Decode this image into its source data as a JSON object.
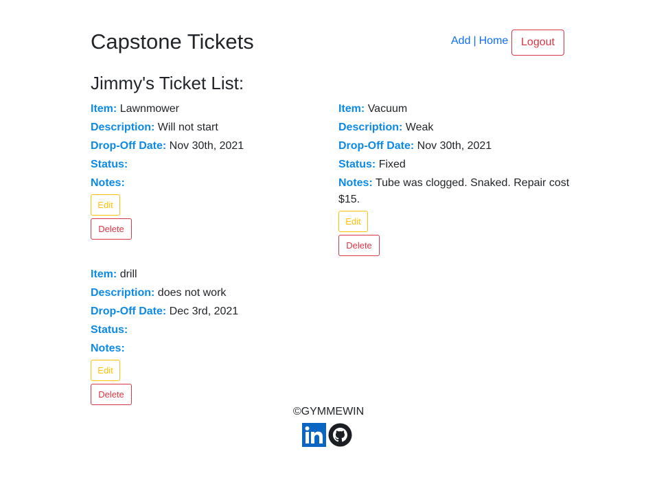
{
  "header": {
    "title": "Capstone Tickets",
    "nav_add": "Add",
    "nav_separator": "|",
    "nav_home": "Home",
    "logout_label": "Logout"
  },
  "list_heading": "Jimmy's Ticket List:",
  "labels": {
    "item": "Item:",
    "description": "Description:",
    "dropoff": "Drop-Off Date:",
    "status": "Status:",
    "notes": "Notes:",
    "edit": "Edit",
    "delete": "Delete"
  },
  "tickets": [
    {
      "item": "Lawnmower",
      "description": "Will not start",
      "dropoff": "Nov 30th, 2021",
      "status": "",
      "notes": ""
    },
    {
      "item": "Vacuum",
      "description": "Weak",
      "dropoff": "Nov 30th, 2021",
      "status": "Fixed",
      "notes": "Tube was clogged. Snaked. Repair cost $15."
    },
    {
      "item": "drill",
      "description": "does not work",
      "dropoff": "Dec 3rd, 2021",
      "status": "",
      "notes": ""
    }
  ],
  "footer": {
    "copyright": "©GYMMEWIN",
    "icons": [
      "linkedin-icon",
      "github-icon"
    ]
  },
  "colors": {
    "label_blue": "#0d8ae6",
    "link_blue": "#0d6efd",
    "danger": "#dc3545",
    "warning": "#ffc107"
  }
}
